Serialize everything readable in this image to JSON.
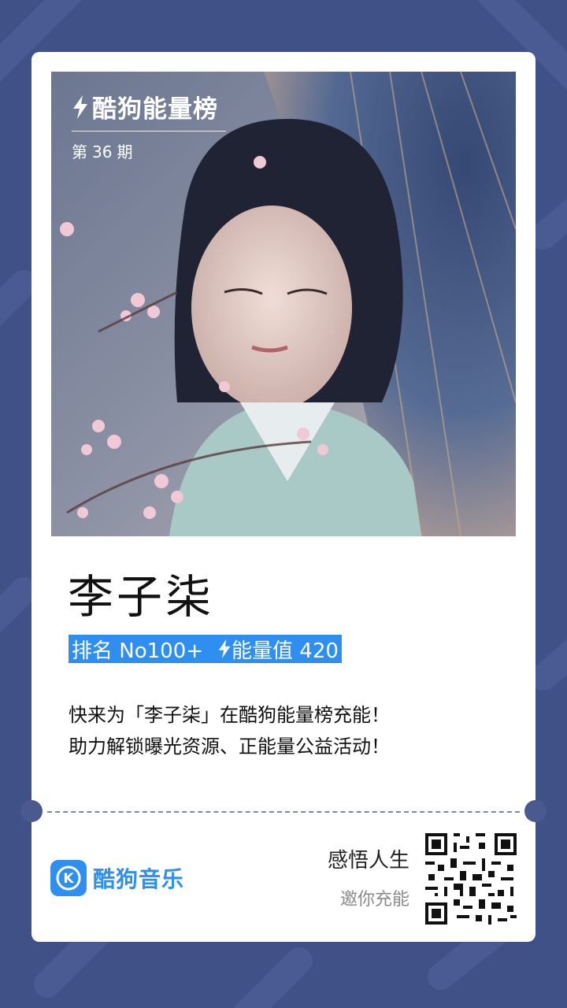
{
  "header": {
    "brand": "酷狗能量榜",
    "issue_prefix": "第",
    "issue_number": "36",
    "issue_suffix": "期"
  },
  "artist": {
    "name": "李子柒",
    "rank_label": "排名 No100+",
    "energy_label": "能量值 420"
  },
  "description": {
    "line1": "快来为「李子柒」在酷狗能量榜充能！",
    "line2": "助力解锁曝光资源、正能量公益活动！"
  },
  "footer": {
    "app_name": "酷狗音乐",
    "logo_letter": "K",
    "invite_title": "感悟人生",
    "invite_sub": "邀你充能"
  },
  "colors": {
    "background": "#3f5187",
    "accent": "#2e8ff0",
    "card": "#ffffff"
  },
  "icons": [
    "lightning-icon",
    "kugou-logo-icon",
    "qr-code"
  ]
}
